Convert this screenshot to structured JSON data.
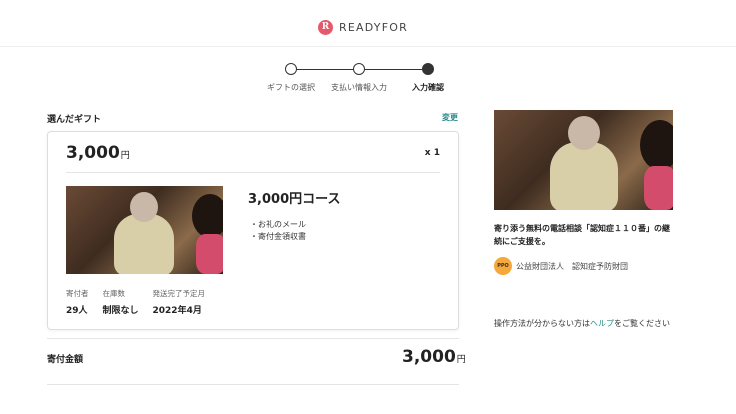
{
  "header": {
    "logo_mark": "R",
    "logo_text": "READYFOR"
  },
  "stepper": {
    "steps": [
      {
        "label": "ギフトの選択",
        "active": false
      },
      {
        "label": "支払い情報入力",
        "active": false
      },
      {
        "label": "入力確認",
        "active": true
      }
    ]
  },
  "selected_gift": {
    "section_title": "選んだギフト",
    "change_label": "変更",
    "price": "3,000",
    "price_unit": "円",
    "quantity": "x 1",
    "course_title": "3,000円コース",
    "bullets": [
      "・お礼のメール",
      "・寄付金領収書"
    ],
    "stats": [
      {
        "label": "寄付者",
        "value": "29人"
      },
      {
        "label": "在庫数",
        "value": "制限なし"
      },
      {
        "label": "発送完了予定月",
        "value": "2022年4月"
      }
    ]
  },
  "total": {
    "label": "寄付金額",
    "amount": "3,000",
    "unit": "円"
  },
  "project": {
    "title": "寄り添う無料の電話相談「認知症１１０番」の継続にご支援を。",
    "org_avatar_text": "PPO",
    "org_name": "公益財団法人　認知症予防財団"
  },
  "help": {
    "prefix": "操作方法が分からない方は",
    "link": "ヘルプ",
    "suffix": "をご覧ください"
  },
  "colors": {
    "accent": "#2a8a8a",
    "brand": "#e55a6a"
  }
}
